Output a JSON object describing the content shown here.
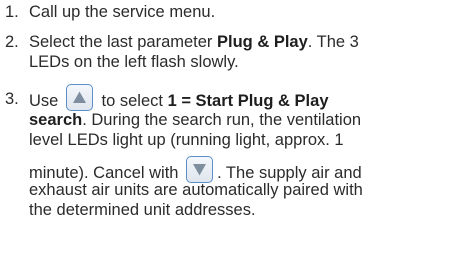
{
  "steps": [
    {
      "number": "1.",
      "text": "Call up the service menu."
    },
    {
      "number": "2.",
      "line1_a": "Select the last parameter ",
      "line1_b": "Plug & Play",
      "line1_c": ". The 3",
      "line2": "LEDs on the left flash slowly."
    },
    {
      "number": "3.",
      "line1_a": "Use ",
      "line1_b": " to select ",
      "line1_c": "1 = Start Plug & Play",
      "line2_a": "search",
      "line2_b": ". During the search run, the ventilation",
      "line3": "level LEDs light up (running light, approx. 1",
      "line4_a": "minute). Cancel with ",
      "line4_b": ". The supply air and",
      "line5": "exhaust air units are automatically paired with",
      "line6": "the determined unit addresses."
    }
  ],
  "icons": {
    "up_button": "up-arrow-button-icon",
    "down_button": "down-arrow-button-icon"
  },
  "colors": {
    "button_border": "#5b8fc9",
    "arrow": "#7e8e9f"
  }
}
